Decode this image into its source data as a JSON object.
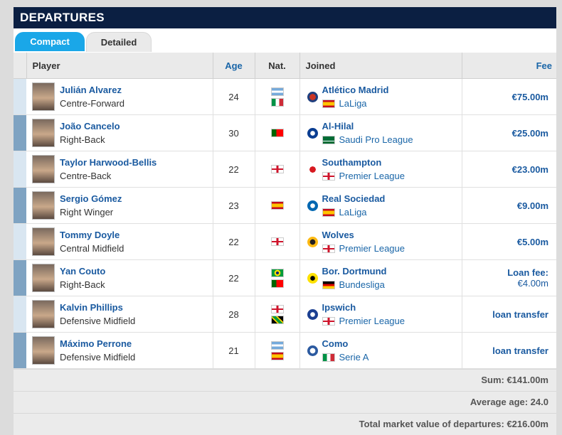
{
  "title": "DEPARTURES",
  "tabs": {
    "compact": "Compact",
    "detailed": "Detailed"
  },
  "columns": {
    "player": "Player",
    "age": "Age",
    "nat": "Nat.",
    "joined": "Joined",
    "fee": "Fee"
  },
  "colors": {
    "header_bg": "#0b1f42",
    "tab_active": "#1aa7e8",
    "link": "#1a5aa0",
    "bar_dark": "#7fa3c2",
    "bar_light": "#d9e6f1"
  },
  "rows": [
    {
      "name": "Julián Alvarez",
      "position": "Centre-Forward",
      "age": "24",
      "nat": [
        "argentina",
        "italy"
      ],
      "club": "Atlético Madrid",
      "league": "LaLiga",
      "league_flag": "spain",
      "fee": "€75.00m",
      "fee2": ""
    },
    {
      "name": "João Cancelo",
      "position": "Right-Back",
      "age": "30",
      "nat": [
        "portugal"
      ],
      "club": "Al-Hilal",
      "league": "Saudi Pro League",
      "league_flag": "saudi",
      "fee": "€25.00m",
      "fee2": ""
    },
    {
      "name": "Taylor Harwood-Bellis",
      "position": "Centre-Back",
      "age": "22",
      "nat": [
        "england"
      ],
      "club": "Southampton",
      "league": "Premier League",
      "league_flag": "england",
      "fee": "€23.00m",
      "fee2": ""
    },
    {
      "name": "Sergio Gómez",
      "position": "Right Winger",
      "age": "23",
      "nat": [
        "spain"
      ],
      "club": "Real Sociedad",
      "league": "LaLiga",
      "league_flag": "spain",
      "fee": "€9.00m",
      "fee2": ""
    },
    {
      "name": "Tommy Doyle",
      "position": "Central Midfield",
      "age": "22",
      "nat": [
        "england"
      ],
      "club": "Wolves",
      "league": "Premier League",
      "league_flag": "england",
      "fee": "€5.00m",
      "fee2": ""
    },
    {
      "name": "Yan Couto",
      "position": "Right-Back",
      "age": "22",
      "nat": [
        "brazil",
        "portugal"
      ],
      "club": "Bor. Dortmund",
      "league": "Bundesliga",
      "league_flag": "germany",
      "fee": "Loan fee:",
      "fee2": "€4.00m"
    },
    {
      "name": "Kalvin Phillips",
      "position": "Defensive Midfield",
      "age": "28",
      "nat": [
        "england",
        "jamaica"
      ],
      "club": "Ipswich",
      "league": "Premier League",
      "league_flag": "england",
      "fee": "loan transfer",
      "fee2": ""
    },
    {
      "name": "Máximo Perrone",
      "position": "Defensive Midfield",
      "age": "21",
      "nat": [
        "argentina",
        "spain"
      ],
      "club": "Como",
      "league": "Serie A",
      "league_flag": "italy",
      "fee": "loan transfer",
      "fee2": ""
    }
  ],
  "summary": {
    "sum": "Sum: €141.00m",
    "avg_age": "Average age: 24.0",
    "market_value": "Total market value of departures: €216.00m"
  }
}
